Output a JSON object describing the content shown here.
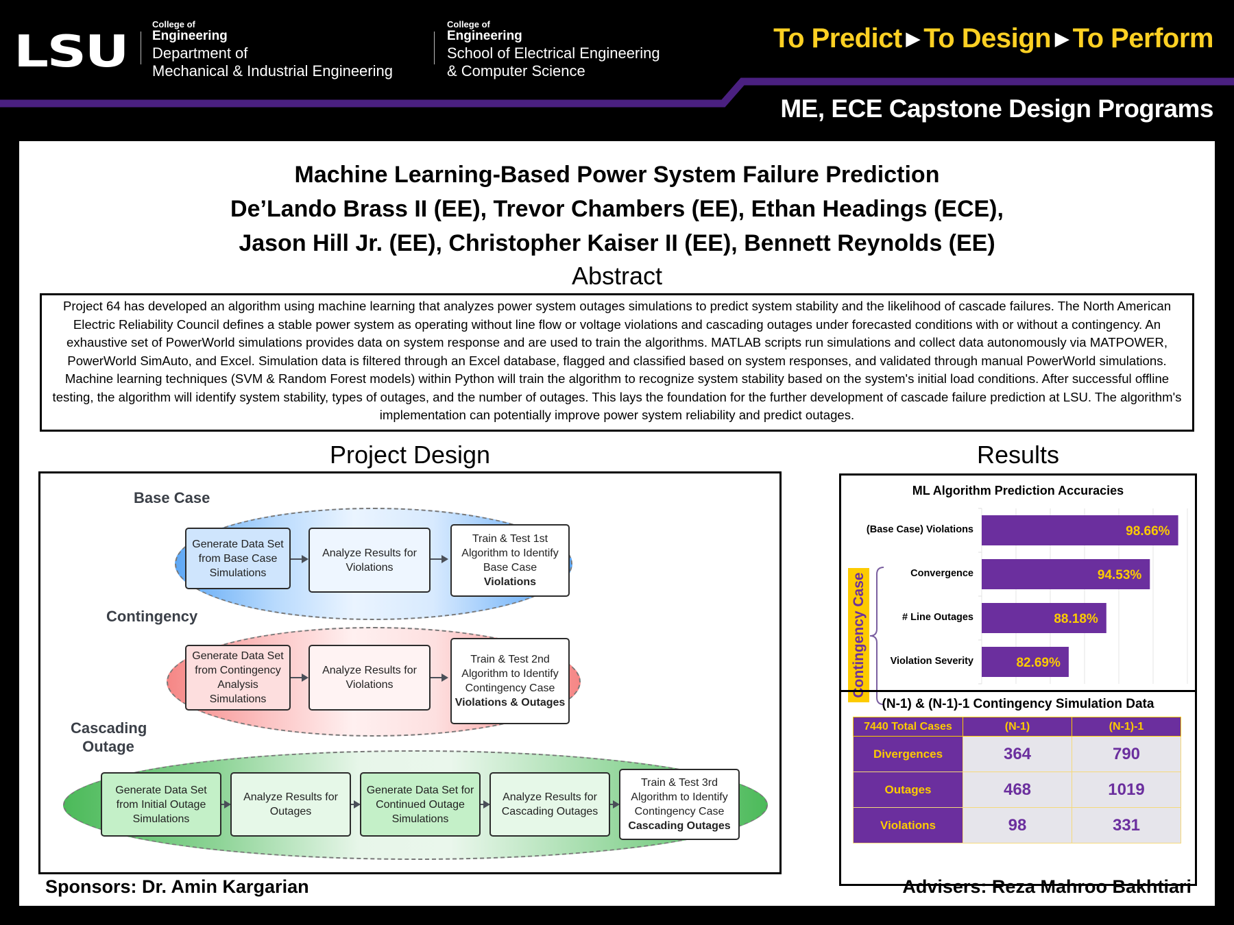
{
  "header": {
    "logo": "LSU",
    "dept1": {
      "college": "College of",
      "engineering": "Engineering",
      "line1": "Department of",
      "line2": "Mechanical & Industrial Engineering"
    },
    "dept2": {
      "college": "College of",
      "engineering": "Engineering",
      "line1": "School of Electrical Engineering",
      "line2": "& Computer Science"
    },
    "tagline": {
      "part1": "To Predict",
      "part2": "To Design",
      "part3": "To Perform",
      "arrow": "▶"
    },
    "programs": "ME, ECE Capstone Design Programs",
    "colors": {
      "purple": "#461d7c",
      "gold": "#fdd023"
    }
  },
  "title": {
    "project": "Machine Learning-Based Power System Failure Prediction",
    "authors_line1": "De’Lando Brass II (EE), Trevor Chambers (EE), Ethan Headings (ECE),",
    "authors_line2": "Jason Hill Jr. (EE), Christopher Kaiser II (EE), Bennett Reynolds (EE)"
  },
  "abstract": {
    "heading": "Abstract",
    "text": "Project 64 has developed an algorithm using machine learning that analyzes power system outages simulations to predict system stability and the likelihood of cascade failures. The North American Electric Reliability Council defines a stable power system as operating without line flow or voltage violations and cascading outages under forecasted conditions with or without a contingency. An exhaustive set of PowerWorld simulations provides data on system response and are used to train the algorithms. MATLAB scripts run simulations and collect data autonomously via MATPOWER, PowerWorld SimAuto, and Excel. Simulation data is filtered through an Excel database, flagged and classified based on system responses, and validated through manual PowerWorld simulations. Machine learning techniques (SVM & Random Forest models) within Python will train the algorithm to recognize system stability based on the system's initial load conditions. After successful offline testing, the algorithm will identify system stability, types of outages, and the number of outages. This lays the foundation for the further development of cascade failure prediction at LSU. The algorithm's implementation can potentially improve power system reliability and predict outages."
  },
  "design": {
    "heading": "Project Design",
    "lanes": [
      {
        "label": "Base Case",
        "color": "#5ea8f5",
        "steps": [
          {
            "text": "Generate Data Set from Base Case Simulations",
            "bold": ""
          },
          {
            "text": "Analyze Results for Violations",
            "bold": ""
          },
          {
            "text": "Train & Test 1st Algorithm to Identify Base Case",
            "bold": "Violations"
          }
        ]
      },
      {
        "label": "Contingency",
        "color": "#f68786",
        "steps": [
          {
            "text": "Generate Data Set from Contingency Analysis Simulations",
            "bold": ""
          },
          {
            "text": "Analyze Results for Violations",
            "bold": ""
          },
          {
            "text": "Train & Test 2nd Algorithm to Identify Contingency Case",
            "bold": "Violations & Outages"
          }
        ]
      },
      {
        "label": "Cascading Outage",
        "color": "#4cba5a",
        "steps": [
          {
            "text": "Generate Data Set from Initial Outage Simulations",
            "bold": ""
          },
          {
            "text": "Analyze Results for Outages",
            "bold": ""
          },
          {
            "text": "Generate Data Set for Continued Outage Simulations",
            "bold": ""
          },
          {
            "text": "Analyze Results for Cascading Outages",
            "bold": ""
          },
          {
            "text": "Train & Test 3rd Algorithm to Identify Contingency Case",
            "bold": "Cascading Outages"
          }
        ]
      }
    ]
  },
  "results": {
    "heading": "Results",
    "group_label": "Contingency Case",
    "table": {
      "title": "(N-1) & (N-1)-1 Contingency Simulation Data",
      "headers": [
        "7440 Total Cases",
        "(N-1)",
        "(N-1)-1"
      ],
      "rows": [
        {
          "label": "Divergences",
          "n1": "364",
          "n11": "790"
        },
        {
          "label": "Outages",
          "n1": "468",
          "n11": "1019"
        },
        {
          "label": "Violations",
          "n1": "98",
          "n11": "331"
        }
      ]
    }
  },
  "chart_data": {
    "type": "bar",
    "orientation": "horizontal",
    "title": "ML Algorithm Prediction Accuracies",
    "categories": [
      "(Base Case) Violations",
      "Convergence",
      "# Line Outages",
      "Violation Severity"
    ],
    "values": [
      98.66,
      94.53,
      88.18,
      82.69
    ],
    "data_labels": [
      "98.66%",
      "94.53%",
      "88.18%",
      "82.69%"
    ],
    "unit": "%",
    "xlim": [
      70,
      100
    ],
    "grid": true,
    "grid_step": 5,
    "xlabel": "",
    "ylabel": "",
    "bar_color": "#6b2f9e",
    "label_color": "#fdcb00"
  },
  "footer": {
    "sponsors": "Sponsors: Dr. Amin Kargarian",
    "advisers": "Advisers: Reza Mahroo Bakhtiari"
  }
}
